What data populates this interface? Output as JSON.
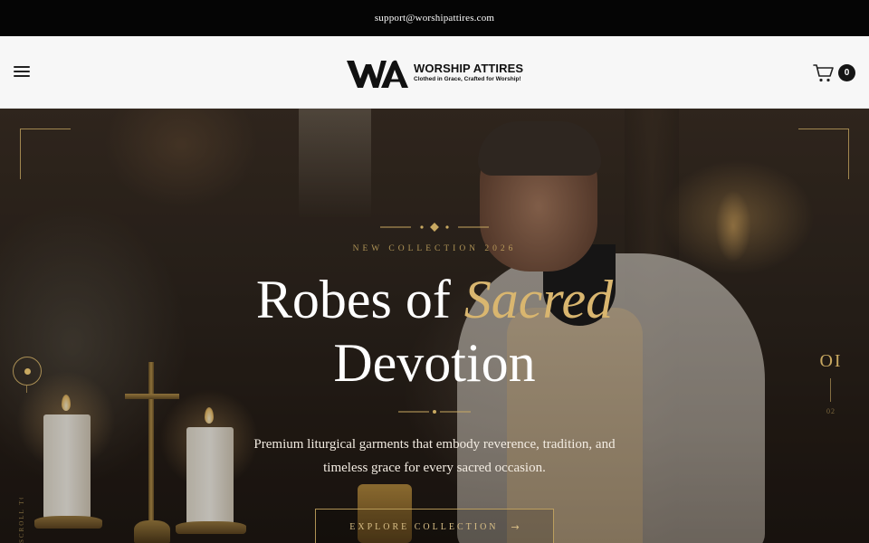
{
  "topbar": {
    "email": "support@worshipattires.com"
  },
  "header": {
    "menu_icon": "hamburger-icon",
    "logo": {
      "name": "WORSHIP ATTIRES",
      "tagline": "Clothed in Grace, Crafted for Worship!"
    },
    "cart": {
      "icon": "cart-icon",
      "count": "0"
    }
  },
  "hero": {
    "eyebrow": "NEW COLLECTION 2026",
    "headline_line1_prefix": "Robes of ",
    "headline_line1_accent": "Sacred",
    "headline_line2": "Devotion",
    "subtext": "Premium liturgical garments that embody reverence, tradition, and timeless grace for every sacred occasion.",
    "cta_label": "EXPLORE COLLECTION",
    "cta_arrow": "→",
    "slide_current": "OI",
    "slide_total": "02",
    "vertical_text": "SCROLL TO EXPLORE"
  },
  "colors": {
    "accent_gold": "#c9a961",
    "topbar_bg": "#050505",
    "header_bg": "#f7f7f7"
  }
}
